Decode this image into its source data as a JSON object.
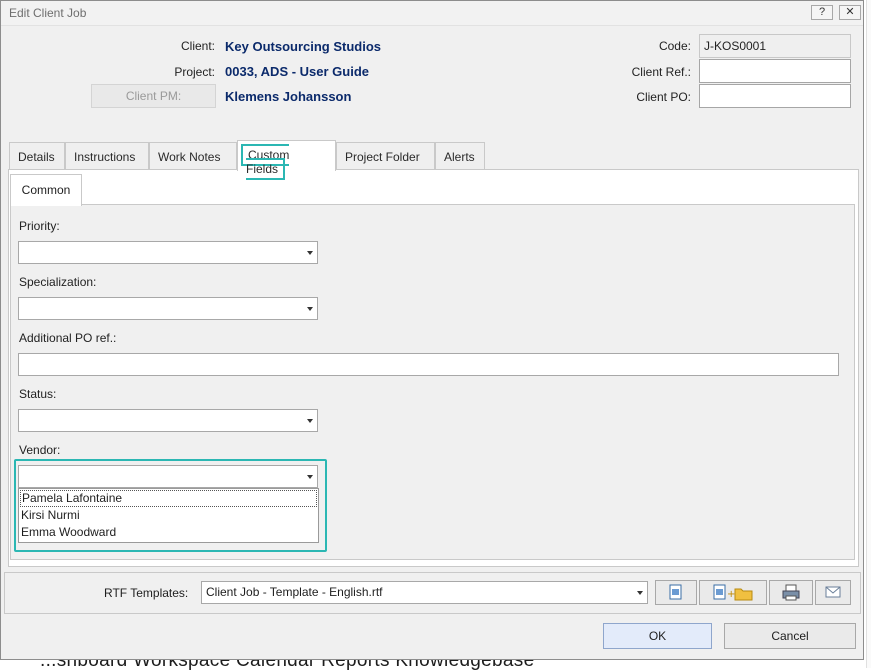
{
  "window": {
    "title": "Edit Client Job",
    "help_glyph": "?",
    "close_glyph": "✕"
  },
  "header": {
    "client_label": "Client:",
    "client_value": "Key Outsourcing Studios",
    "project_label": "Project:",
    "project_value": "0033, ADS - User Guide",
    "client_pm_button": "Client PM:",
    "client_pm_value": "Klemens Johansson",
    "code_label": "Code:",
    "code_value": "J-KOS0001",
    "client_ref_label": "Client Ref.:",
    "client_ref_value": "",
    "client_po_label": "Client PO:",
    "client_po_value": ""
  },
  "tabs": [
    "Details",
    "Instructions",
    "Work Notes",
    "Custom Fields",
    "Project Folder",
    "Alerts"
  ],
  "active_tab": "Custom Fields",
  "subtab": "Common",
  "fields": {
    "priority_label": "Priority:",
    "priority_value": "",
    "specialization_label": "Specialization:",
    "specialization_value": "",
    "additional_po_label": "Additional PO ref.:",
    "additional_po_value": "",
    "status_label": "Status:",
    "status_value": "",
    "vendor_label": "Vendor:",
    "vendor_value": "",
    "vendor_options": [
      "Pamela Lafontaine",
      "Kirsi Nurmi",
      "Emma Woodward"
    ]
  },
  "footer": {
    "rtf_label": "RTF Templates:",
    "rtf_value": "Client Job - Template - English.rtf"
  },
  "buttons": {
    "ok": "OK",
    "cancel": "Cancel"
  },
  "background_text": "...shboard   Workspace   Calendar   Reports   Knowledgebase",
  "colors": {
    "highlight": "#2bb7b3",
    "value_text": "#0b2a6b",
    "ok_button": "#e3ebfa"
  }
}
